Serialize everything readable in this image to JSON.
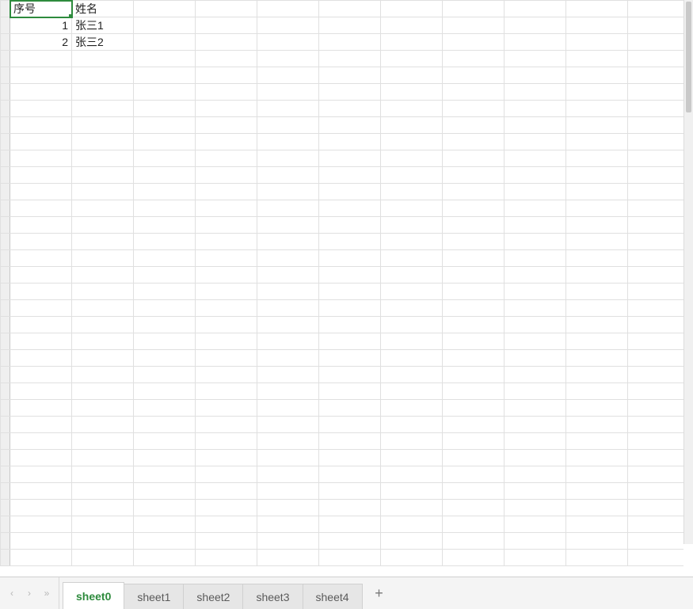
{
  "spreadsheet": {
    "selected_cell": {
      "row": 0,
      "col": 0
    },
    "columns_visible": 11,
    "rows_visible": 34,
    "headers": [
      "序号",
      "姓名"
    ],
    "rows": [
      {
        "seq": "1",
        "name": "张三1"
      },
      {
        "seq": "2",
        "name": "张三2"
      }
    ]
  },
  "tabs": {
    "items": [
      {
        "label": "sheet0",
        "active": true
      },
      {
        "label": "sheet1",
        "active": false
      },
      {
        "label": "sheet2",
        "active": false
      },
      {
        "label": "sheet3",
        "active": false
      },
      {
        "label": "sheet4",
        "active": false
      }
    ],
    "add_icon": "+",
    "nav": {
      "first": "«",
      "prev": "‹",
      "next": "›",
      "last": "»"
    }
  },
  "colors": {
    "accent": "#2e8b3d",
    "grid_line": "#e0e0e0",
    "tab_inactive_bg": "#e6e6e6",
    "tab_active_bg": "#ffffff"
  }
}
